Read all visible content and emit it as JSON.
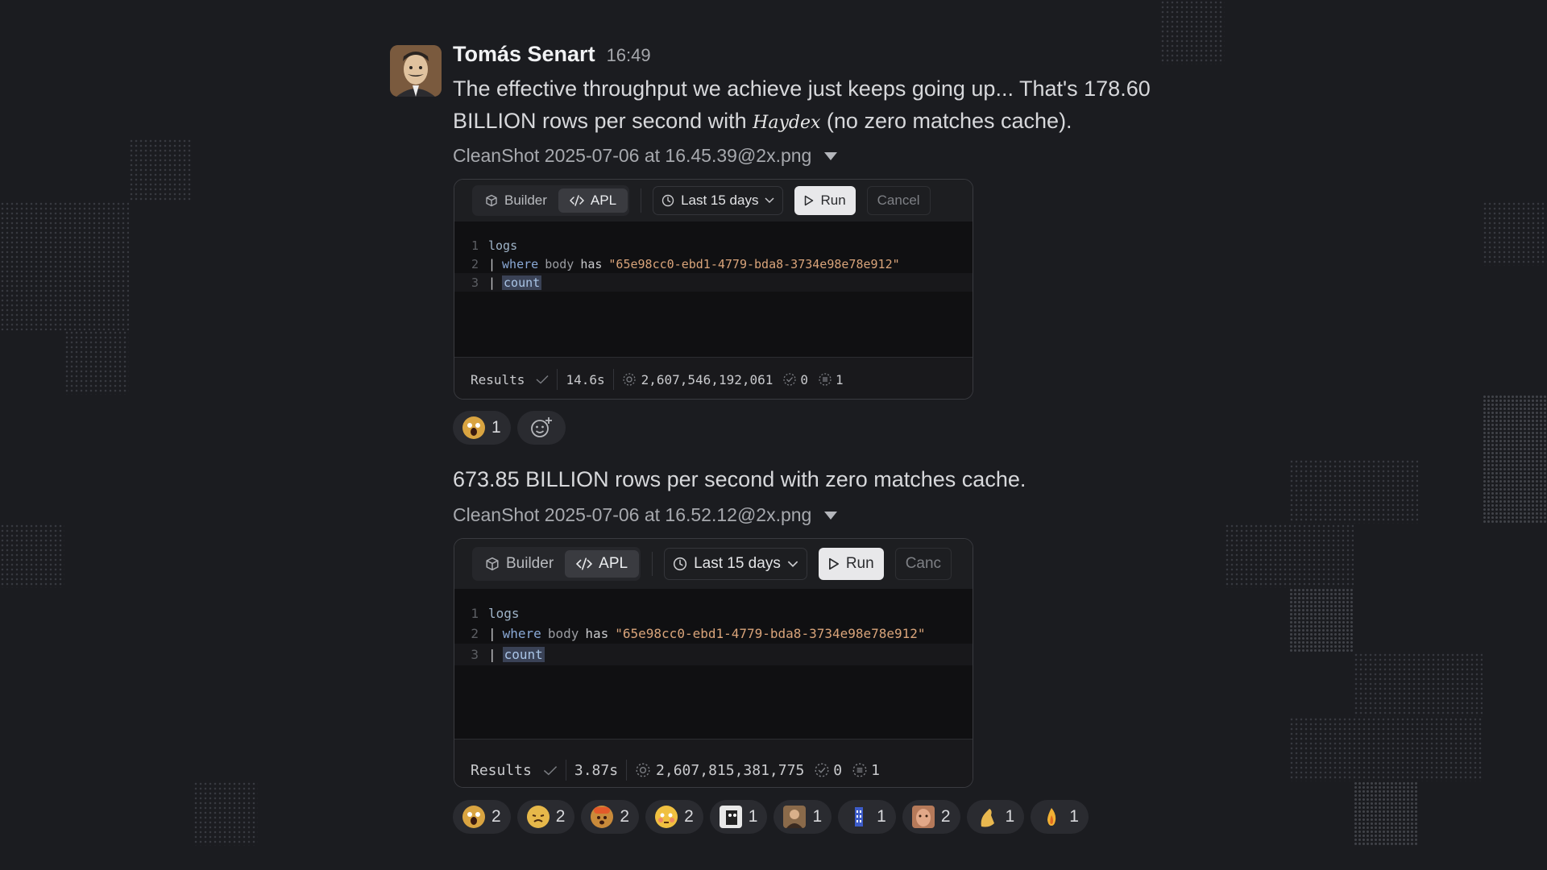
{
  "message": {
    "author": "Tomás Senart",
    "time": "16:49",
    "line1": "The effective throughput we achieve just keeps going up... That's 178.60",
    "line2_pre": "BILLION rows per second with ",
    "line2_brand": "Haydex",
    "line2_post": " (no zero matches cache).",
    "second_text": "673.85 BILLION rows per second with zero matches cache."
  },
  "attachments": [
    {
      "filename": "CleanShot 2025-07-06 at 16.45.39@2x.png",
      "toolbar": {
        "builder": "Builder",
        "apl": "APL",
        "range": "Last 15 days",
        "run": "Run",
        "cancel": "Cancel"
      },
      "code": {
        "line_numbers": [
          "1",
          "2",
          "3"
        ],
        "source": "logs",
        "pipe": "|",
        "where": "where",
        "field": "body",
        "op": "has",
        "value": "\"65e98cc0-ebd1-4779-bda8-3734e98e78e912\"",
        "count": "count"
      },
      "results": {
        "label": "Results",
        "duration": "14.6s",
        "rows": "2,607,546,192,061",
        "matches": "0",
        "groups": "1"
      }
    },
    {
      "filename": "CleanShot 2025-07-06 at 16.52.12@2x.png",
      "toolbar": {
        "builder": "Builder",
        "apl": "APL",
        "range": "Last 15 days",
        "run": "Run",
        "cancel": "Canc"
      },
      "code": {
        "line_numbers": [
          "1",
          "2",
          "3"
        ],
        "source": "logs",
        "pipe": "|",
        "where": "where",
        "field": "body",
        "op": "has",
        "value": "\"65e98cc0-ebd1-4779-bda8-3734e98e78e912\"",
        "count": "count"
      },
      "results": {
        "label": "Results",
        "duration": "3.87s",
        "rows": "2,607,815,381,775",
        "matches": "0",
        "groups": "1"
      }
    }
  ],
  "reactions_first": [
    {
      "emoji": "screaming-face-emoji",
      "count": "1",
      "color": "#d9a441"
    }
  ],
  "reactions_second": [
    {
      "emoji": "screaming-face-emoji",
      "count": "2",
      "color": "#d9a441"
    },
    {
      "emoji": "exploding-face-emoji",
      "count": "2",
      "color": "#e6b84a"
    },
    {
      "emoji": "mind-blown-emoji",
      "count": "2",
      "color": "#c98a3a"
    },
    {
      "emoji": "flushed-face-emoji",
      "count": "2",
      "color": "#f0c040"
    },
    {
      "emoji": "custom-portrait-emoji",
      "count": "1",
      "color": "#e8e8e8"
    },
    {
      "emoji": "custom-person-emoji",
      "count": "1",
      "color": "#8a6a4a"
    },
    {
      "emoji": "custom-tower-emoji",
      "count": "1",
      "color": "#3d5cc9"
    },
    {
      "emoji": "custom-face-emoji",
      "count": "2",
      "color": "#b67a5a"
    },
    {
      "emoji": "pinched-fingers-emoji",
      "count": "1",
      "color": "#e9b84f"
    },
    {
      "emoji": "fire-emoji",
      "count": "1",
      "color": "#f2b134"
    }
  ],
  "add_reaction_icon": "add-reaction-icon"
}
